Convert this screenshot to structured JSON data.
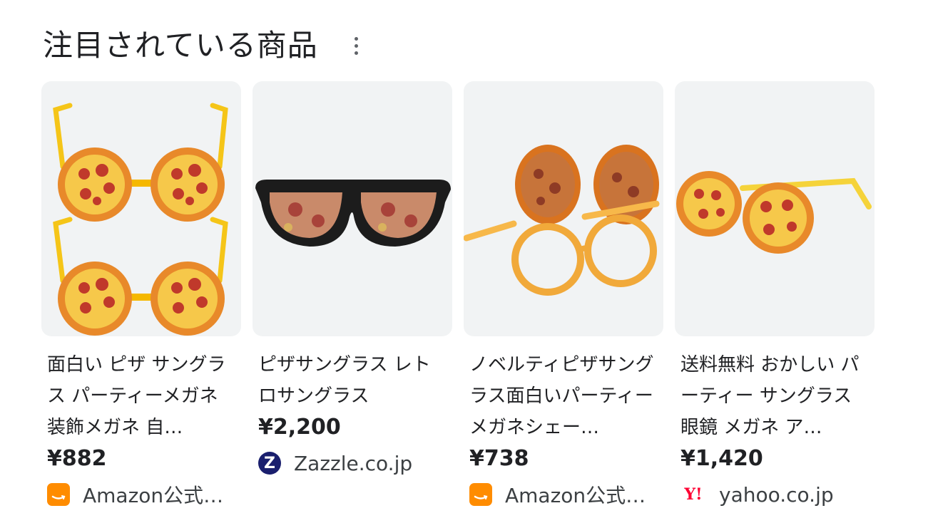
{
  "section": {
    "title": "注目されている商品"
  },
  "products": [
    {
      "name": "面白い ピザ サングラス パーティーメガネ 装飾メガネ 自…",
      "price": "¥882",
      "seller": "Amazon公式…",
      "seller_icon": "amazon-icon",
      "image": "pizza-flip-sunglasses-pair"
    },
    {
      "name": "ピザサングラス レトロサングラス",
      "price": "¥2,200",
      "seller": "Zazzle.co.jp",
      "seller_icon": "zazzle-icon",
      "image": "pizza-wayfarer-sunglasses"
    },
    {
      "name": "ノベルティピザサングラス面白いパーティーメガネシェー…",
      "price": "¥738",
      "seller": "Amazon公式…",
      "seller_icon": "amazon-icon",
      "image": "pizza-flip-up-glasses"
    },
    {
      "name": "送料無料 おかしい パーティー サングラス 眼鏡 メガネ ア…",
      "price": "¥1,420",
      "seller": "yahoo.co.jp",
      "seller_icon": "yahoo-icon",
      "image": "pizza-round-sunglasses"
    }
  ],
  "colors": {
    "amazon": "#ff8c00",
    "zazzle": "#1a1f6e",
    "yahoo": "#ff0033",
    "card_bg": "#f1f3f4"
  }
}
